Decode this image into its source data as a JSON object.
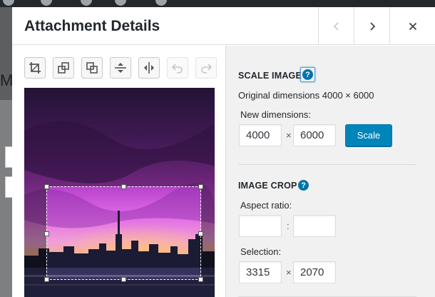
{
  "modal": {
    "title": "Attachment Details"
  },
  "background": {
    "peek_letter": "M"
  },
  "sidebar": {
    "scale": {
      "heading": "SCALE IMAGE",
      "help_glyph": "?",
      "original_dimensions": "Original dimensions 4000 × 6000",
      "new_dimensions_label": "New dimensions:",
      "width_value": "4000",
      "height_value": "6000",
      "separator": "×",
      "button_label": "Scale"
    },
    "crop": {
      "heading": "IMAGE CROP",
      "help_glyph": "?",
      "aspect_ratio_label": "Aspect ratio:",
      "aspect_w": "",
      "aspect_h": "",
      "aspect_separator": ":",
      "selection_label": "Selection:",
      "selection_w": "3315",
      "selection_h": "2070",
      "selection_separator": "×"
    }
  },
  "toolbar": {
    "tools": [
      "crop-icon",
      "rotate-left-icon",
      "rotate-right-icon",
      "flip-vertical-icon",
      "flip-horizontal-icon",
      "undo-icon",
      "redo-icon"
    ]
  },
  "colors": {
    "accent": "#0085ba",
    "help": "#0073aa",
    "sidebar_bg": "#f1f1f1"
  }
}
